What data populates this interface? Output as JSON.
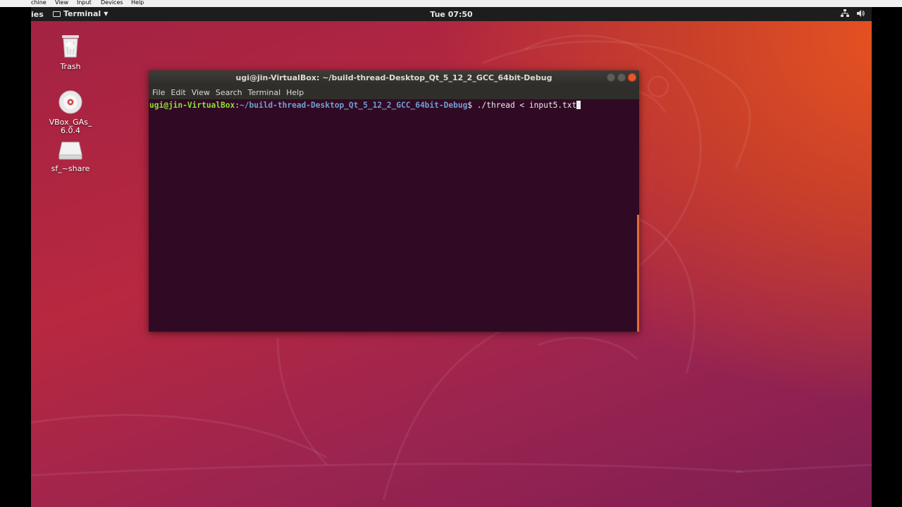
{
  "vbox_menu": [
    "chine",
    "View",
    "Input",
    "Devices",
    "Help"
  ],
  "top_panel": {
    "activities": "ies",
    "app_name": "Terminal",
    "clock": "Tue 07:50",
    "tray_icons": [
      "network-icon",
      "volume-icon"
    ]
  },
  "desktop_icons": [
    {
      "label": "Trash",
      "icon": "trash-icon"
    },
    {
      "label": "VBox_GAs_\n6.0.4",
      "icon": "optical-disc-icon"
    },
    {
      "label": "sf_~share",
      "icon": "drive-icon"
    }
  ],
  "terminal": {
    "title": "ugi@jin-VirtualBox: ~/build-thread-Desktop_Qt_5_12_2_GCC_64bit-Debug",
    "menu": [
      "File",
      "Edit",
      "View",
      "Search",
      "Terminal",
      "Help"
    ],
    "prompt_user": "ugi@jin-VirtualBox",
    "prompt_sep": ":",
    "prompt_path": "~/build-thread-Desktop_Qt_5_12_2_GCC_64bit-Debug",
    "prompt_symbol": "$ ",
    "command": "./thread < input5.txt"
  },
  "colors": {
    "terminal_bg": "#300a24",
    "prompt_user": "#8ae234",
    "prompt_path": "#729fcf",
    "accent": "#e95420"
  }
}
